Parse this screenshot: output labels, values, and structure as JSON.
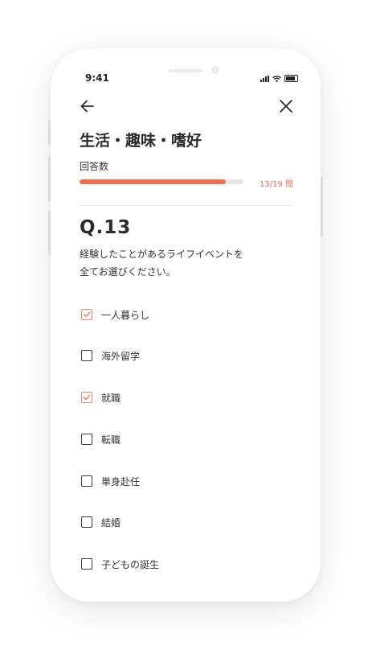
{
  "status_bar": {
    "time": "9:41"
  },
  "header": {
    "title": "生活・趣味・嗜好"
  },
  "progress": {
    "label": "回答数",
    "count_text": "13/19 問",
    "fraction": 0.89
  },
  "question": {
    "number": "Q.13",
    "text_line1": "経験したことがあるライフイベントを",
    "text_line2": "全てお選びください。"
  },
  "options": [
    {
      "label": "一人暮らし",
      "checked": true
    },
    {
      "label": "海外留学",
      "checked": false
    },
    {
      "label": "就職",
      "checked": true
    },
    {
      "label": "転職",
      "checked": false
    },
    {
      "label": "単身赴任",
      "checked": false
    },
    {
      "label": "結婚",
      "checked": false
    },
    {
      "label": "子どもの誕生",
      "checked": false
    }
  ],
  "colors": {
    "accent": "#f26d4e",
    "text": "#2b2b2b",
    "track": "#e6e6e9"
  },
  "icons": {
    "back": "arrow-left-icon",
    "close": "close-icon"
  }
}
